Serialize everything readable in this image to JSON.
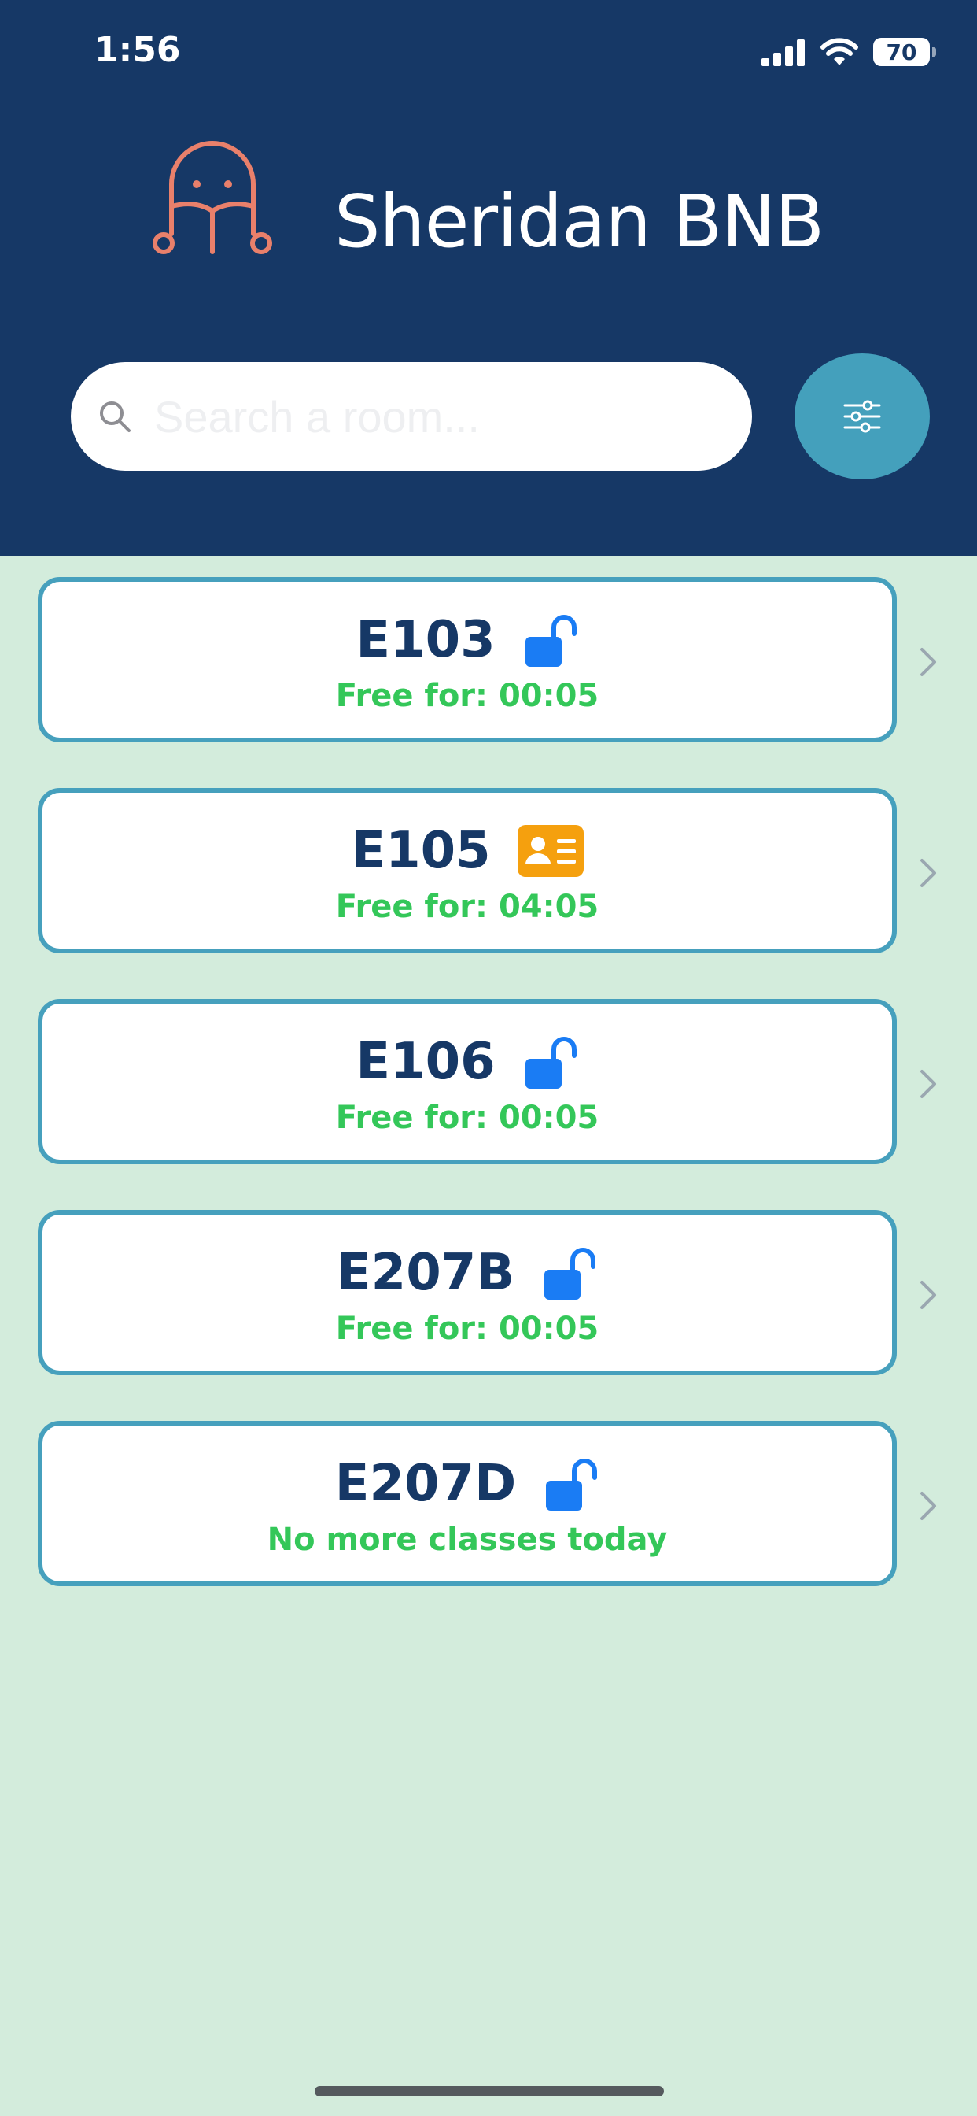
{
  "status_bar": {
    "time": "1:56",
    "battery": "70"
  },
  "app": {
    "title": "Sheridan BNB"
  },
  "search": {
    "placeholder": "Search a room..."
  },
  "colors": {
    "header": "#163866",
    "background": "#d3ecdc",
    "accent": "#46a0bd",
    "free_text": "#34c759",
    "lock": "#1a7cf4",
    "badge": "#f5a00e",
    "logo": "#e9806b"
  },
  "rooms": [
    {
      "name": "E103",
      "icon": "unlock-icon",
      "status": "Free for: 00:05"
    },
    {
      "name": "E105",
      "icon": "id-card-icon",
      "status": "Free for: 04:05"
    },
    {
      "name": "E106",
      "icon": "unlock-icon",
      "status": "Free for: 00:05"
    },
    {
      "name": "E207B",
      "icon": "unlock-icon",
      "status": "Free for: 00:05"
    },
    {
      "name": "E207D",
      "icon": "unlock-icon",
      "status": "No more classes today"
    }
  ]
}
